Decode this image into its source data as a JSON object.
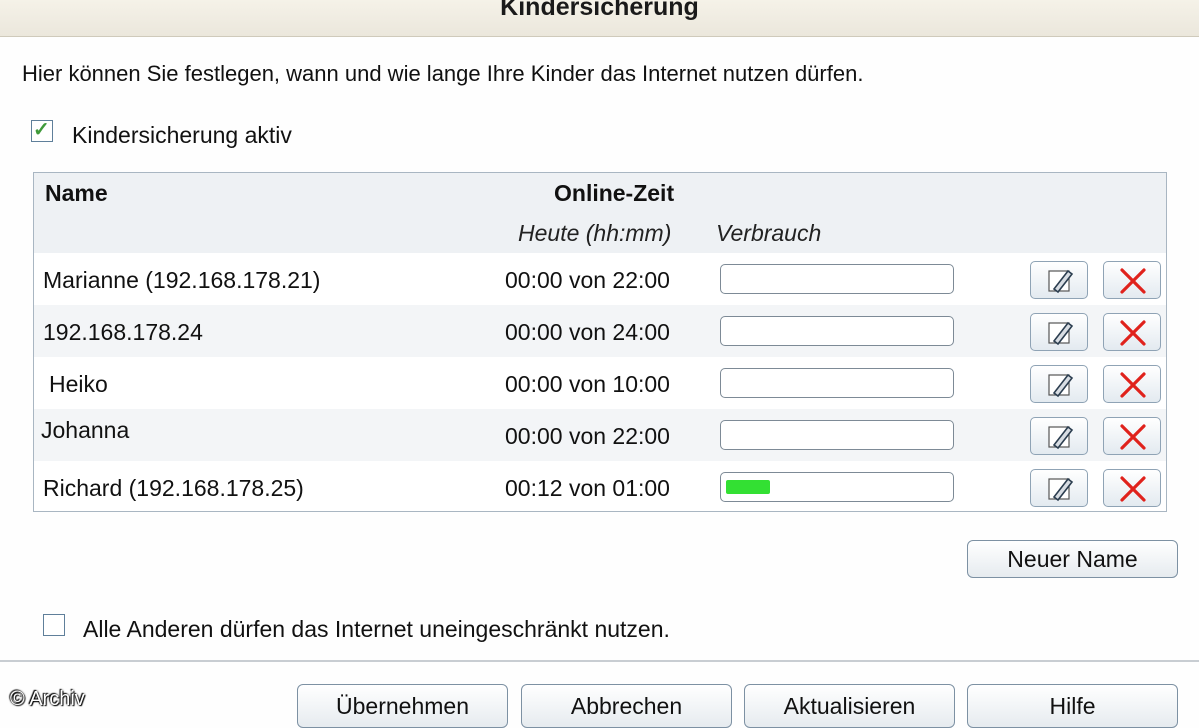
{
  "header": {
    "title": "Kindersicherung"
  },
  "intro": "Hier können Sie festlegen, wann und wie lange Ihre Kinder das Internet nutzen dürfen.",
  "active": {
    "label": "Kindersicherung aktiv",
    "checked": true
  },
  "table": {
    "col_name": "Name",
    "col_online": "Online-Zeit",
    "col_today": "Heute (hh:mm)",
    "col_usage": "Verbrauch",
    "rows": [
      {
        "name": "Marianne  (192.168.178.21)",
        "time": "00:00 von 22:00",
        "usage": 0
      },
      {
        "name": "192.168.178.24",
        "time": "00:00 von 24:00",
        "usage": 0
      },
      {
        "name": "Heiko",
        "time": "00:00 von 10:00",
        "usage": 0
      },
      {
        "name": "Johanna",
        "time": "00:00 von 22:00",
        "usage": 0
      },
      {
        "name": "Richard  (192.168.178.25)",
        "time": "00:12 von 01:00",
        "usage": 0.2
      }
    ]
  },
  "new_name_button": "Neuer Name",
  "others": {
    "label": "Alle Anderen dürfen das Internet uneingeschränkt nutzen.",
    "checked": false
  },
  "footer": {
    "apply": "Übernehmen",
    "cancel": "Abbrechen",
    "refresh": "Aktualisieren",
    "help": "Hilfe"
  },
  "watermark": "© Archiv",
  "colors": {
    "usage_fill": "#33e033",
    "delete_icon": "#e0221c",
    "edit_icon": "#2c3e50"
  }
}
